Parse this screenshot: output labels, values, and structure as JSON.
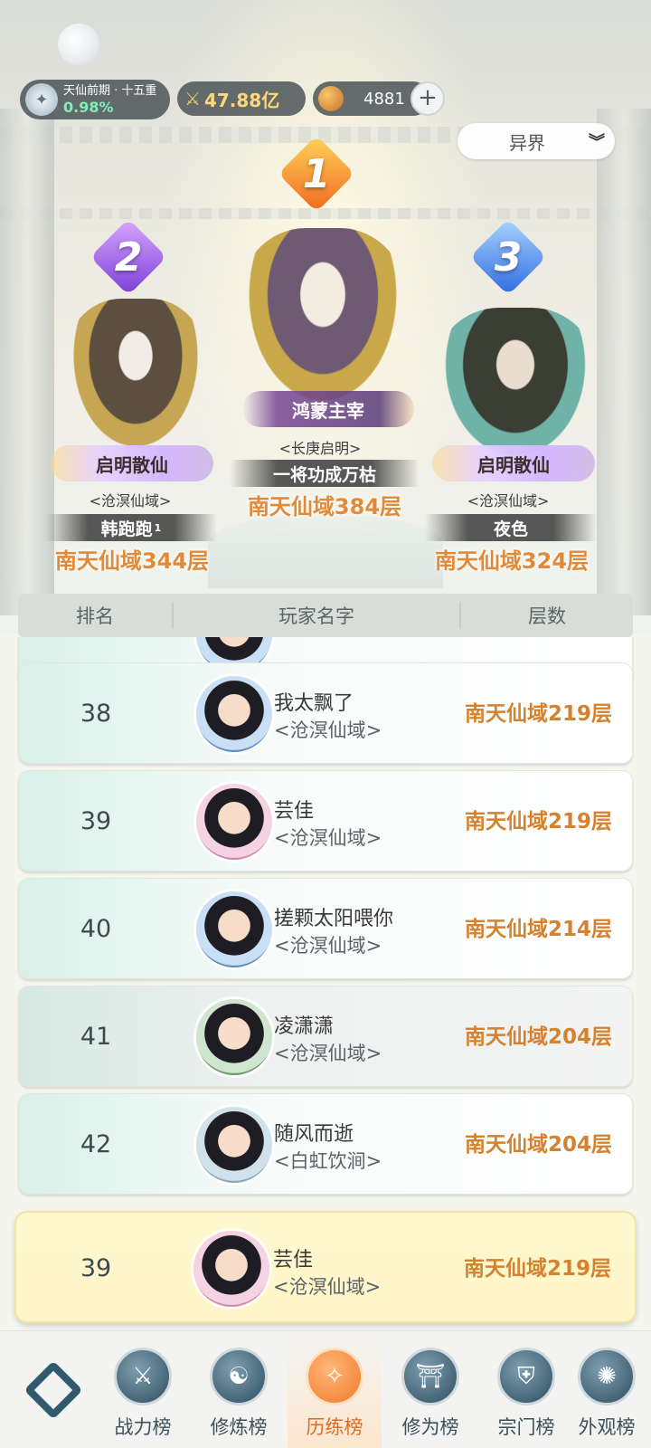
{
  "status": {
    "realm_name": "天仙前期 · 十五重",
    "realm_progress": "0.98%",
    "power": "47.88亿",
    "coins": "4881",
    "plus_label": "+"
  },
  "world_select": {
    "value": "异界"
  },
  "podium": {
    "first": {
      "rank": "1",
      "title": "鸿蒙主宰",
      "server": "<长庚启明>",
      "name": "一将功成万枯",
      "floor": "南天仙域384层"
    },
    "second": {
      "rank": "2",
      "title": "启明散仙",
      "server": "<沧溟仙域>",
      "name": "韩跑跑",
      "name_sup": "1",
      "floor": "南天仙域344层"
    },
    "third": {
      "rank": "3",
      "title": "启明散仙",
      "server": "<沧溟仙域>",
      "name": "夜色",
      "floor": "南天仙域324层"
    }
  },
  "list_header": {
    "rank": "排名",
    "name": "玩家名字",
    "floor": "层数"
  },
  "rows": [
    {
      "rank": "38",
      "name": "我太飘了",
      "server": "<沧溟仙域>",
      "floor": "南天仙域219层"
    },
    {
      "rank": "39",
      "name": "芸佳",
      "server": "<沧溟仙域>",
      "floor": "南天仙域219层"
    },
    {
      "rank": "40",
      "name": "搓颗太阳喂你",
      "server": "<沧溟仙域>",
      "floor": "南天仙域214层"
    },
    {
      "rank": "41",
      "name": "凌潇潇",
      "server": "<沧溟仙域>",
      "floor": "南天仙域204层"
    },
    {
      "rank": "42",
      "name": "随风而逝",
      "server": "<白虹饮涧>",
      "floor": "南天仙域204层"
    }
  ],
  "my_rank": {
    "rank": "39",
    "name": "芸佳",
    "server": "<沧溟仙域>",
    "floor": "南天仙域219层"
  },
  "nav": {
    "items": [
      {
        "label": "战力榜",
        "icon": "sword-icon"
      },
      {
        "label": "修炼榜",
        "icon": "yin-yang-icon"
      },
      {
        "label": "历练榜",
        "icon": "star-compass-icon"
      },
      {
        "label": "修为榜",
        "icon": "hat-icon"
      },
      {
        "label": "宗门榜",
        "icon": "gate-icon"
      },
      {
        "label": "外观榜",
        "icon": "robe-icon"
      }
    ],
    "active_index": 2
  },
  "colors": {
    "accent": "#e18a3a",
    "floor_text": "#d4822f",
    "progress_green": "#7ff0b8"
  }
}
